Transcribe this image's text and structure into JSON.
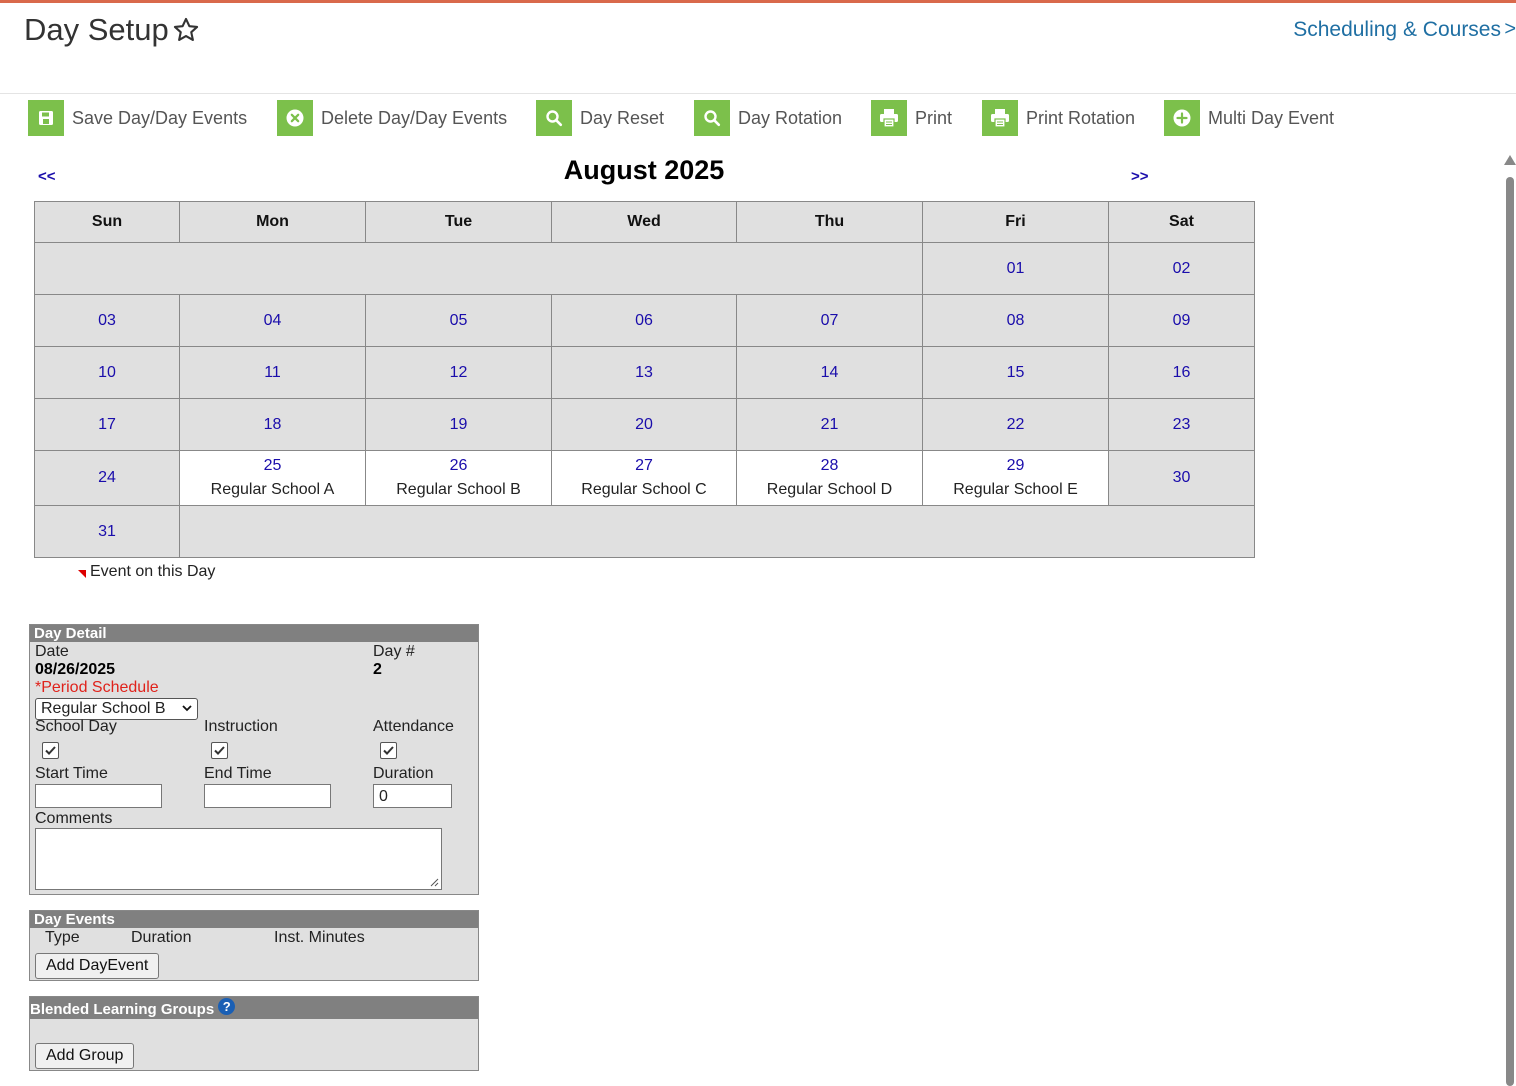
{
  "header": {
    "title": "Day Setup",
    "breadcrumb": "Scheduling & Courses",
    "breadcrumb_arrow": ">"
  },
  "toolbar": {
    "items": [
      {
        "label": "Save Day/Day Events",
        "icon": "save-icon"
      },
      {
        "label": "Delete Day/Day Events",
        "icon": "delete-icon"
      },
      {
        "label": "Day Reset",
        "icon": "search-icon"
      },
      {
        "label": "Day Rotation",
        "icon": "search-icon"
      },
      {
        "label": "Print",
        "icon": "print-icon"
      },
      {
        "label": "Print Rotation",
        "icon": "print-icon"
      },
      {
        "label": "Multi Day Event",
        "icon": "add-icon"
      }
    ],
    "icon_color": "#7cc04b"
  },
  "calendar": {
    "prev": "<<",
    "next": ">>",
    "month_title": "August 2025",
    "weekdays": [
      "Sun",
      "Mon",
      "Tue",
      "Wed",
      "Thu",
      "Fri",
      "Sat"
    ],
    "days": {
      "d01": "01",
      "d02": "02",
      "d03": "03",
      "d04": "04",
      "d05": "05",
      "d06": "06",
      "d07": "07",
      "d08": "08",
      "d09": "09",
      "d10": "10",
      "d11": "11",
      "d12": "12",
      "d13": "13",
      "d14": "14",
      "d15": "15",
      "d16": "16",
      "d17": "17",
      "d18": "18",
      "d19": "19",
      "d20": "20",
      "d21": "21",
      "d22": "22",
      "d23": "23",
      "d24": "24",
      "d25": "25",
      "d26": "26",
      "d27": "27",
      "d28": "28",
      "d29": "29",
      "d30": "30",
      "d31": "31"
    },
    "events": {
      "d25": "Regular School A",
      "d26": "Regular School B",
      "d27": "Regular School C",
      "d28": "Regular School D",
      "d29": "Regular School E"
    },
    "legend": "Event on this Day"
  },
  "day_detail": {
    "heading": "Day Detail",
    "date_label": "Date",
    "date_value": "08/26/2025",
    "day_num_label": "Day #",
    "day_num_value": "2",
    "period_schedule_label": "*Period Schedule",
    "period_schedule_value": "Regular School B",
    "school_day_label": "School Day",
    "instruction_label": "Instruction",
    "attendance_label": "Attendance",
    "school_day_checked": true,
    "instruction_checked": true,
    "attendance_checked": true,
    "start_time_label": "Start Time",
    "end_time_label": "End Time",
    "duration_label": "Duration",
    "start_time_value": "",
    "end_time_value": "",
    "duration_value": "0",
    "comments_label": "Comments"
  },
  "day_events": {
    "heading": "Day Events",
    "col_type": "Type",
    "col_duration": "Duration",
    "col_inst_minutes": "Inst. Minutes",
    "add_button": "Add DayEvent"
  },
  "blended": {
    "heading": "Blended Learning Groups",
    "help": "?",
    "add_button": "Add Group"
  }
}
